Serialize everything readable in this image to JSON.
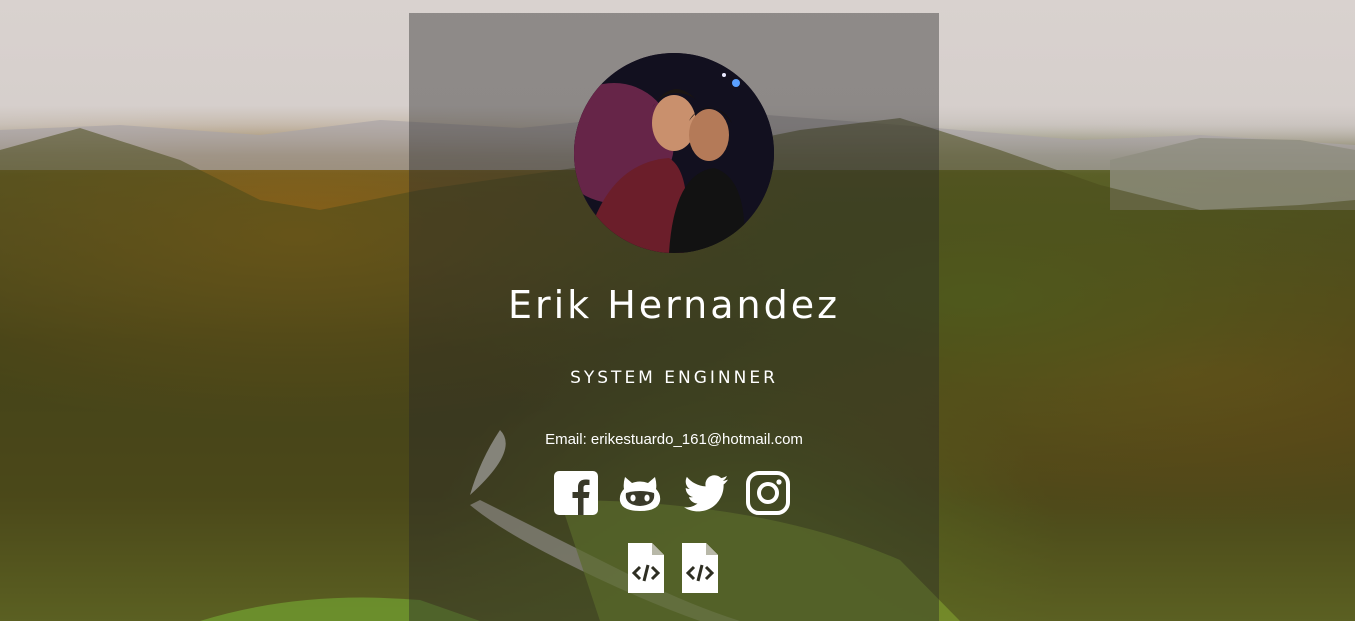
{
  "profile": {
    "name": "Erik Hernandez",
    "role": "SYSTEM ENGINNER",
    "email": "Email: erikestuardo_161@hotmail.com"
  },
  "social_links": [
    {
      "icon": "facebook-icon"
    },
    {
      "icon": "github-icon"
    },
    {
      "icon": "twitter-icon"
    },
    {
      "icon": "instagram-icon"
    }
  ],
  "file_links": [
    {
      "icon": "code-file-icon"
    },
    {
      "icon": "code-file-icon"
    }
  ],
  "colors": {
    "text": "#ffffff",
    "panel_overlay": "rgba(40,40,40,0.42)"
  }
}
